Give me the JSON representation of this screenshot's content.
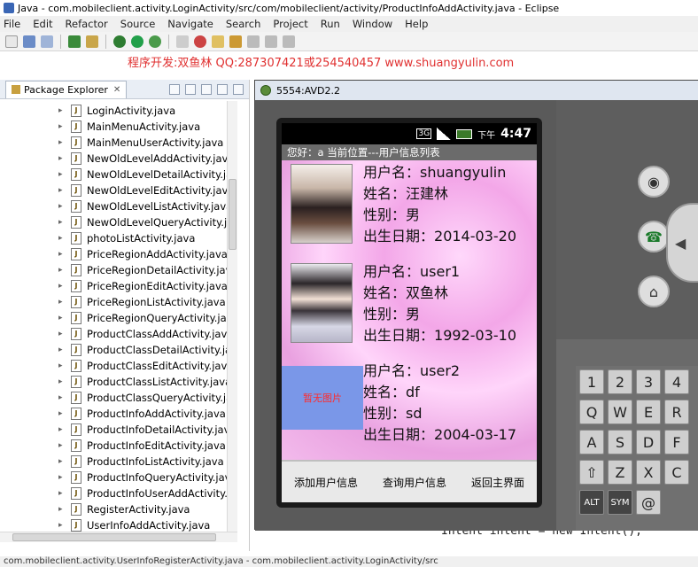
{
  "window": {
    "title": "Java - com.mobileclient.activity.LoginActivity/src/com/mobileclient/activity/ProductInfoAddActivity.java - Eclipse"
  },
  "menu": [
    "File",
    "Edit",
    "Refactor",
    "Source",
    "Navigate",
    "Search",
    "Project",
    "Run",
    "Window",
    "Help"
  ],
  "promo_text": "程序开发:双鱼林 QQ:287307421或254540457 www.shuangyulin.com",
  "package_explorer": {
    "tab_label": "Package Explorer",
    "files": [
      "LoginActivity.java",
      "MainMenuActivity.java",
      "MainMenuUserActivity.java",
      "NewOldLevelAddActivity.java",
      "NewOldLevelDetailActivity.java",
      "NewOldLevelEditActivity.java",
      "NewOldLevelListActivity.java",
      "NewOldLevelQueryActivity.java",
      "photoListActivity.java",
      "PriceRegionAddActivity.java",
      "PriceRegionDetailActivity.java",
      "PriceRegionEditActivity.java",
      "PriceRegionListActivity.java",
      "PriceRegionQueryActivity.java",
      "ProductClassAddActivity.java",
      "ProductClassDetailActivity.java",
      "ProductClassEditActivity.java",
      "ProductClassListActivity.java",
      "ProductClassQueryActivity.java",
      "ProductInfoAddActivity.java",
      "ProductInfoDetailActivity.java",
      "ProductInfoEditActivity.java",
      "ProductInfoListActivity.java",
      "ProductInfoQueryActivity.java",
      "ProductInfoUserAddActivity.java",
      "RegisterActivity.java",
      "UserInfoAddActivity.java"
    ]
  },
  "editor": {
    "code_line_keyword": "Intent intent = new Intent();"
  },
  "emulator": {
    "title": "5554:AVD2.2",
    "status_bar": {
      "ampm": "下午",
      "time": "4:47"
    },
    "appbar_text": "您好：a   当前位置---用户信息列表",
    "users": [
      {
        "username_label": "用户名：",
        "username": "shuangyulin",
        "name_label": "姓名：",
        "name": "汪建林",
        "gender_label": "性别：",
        "gender": "男",
        "birth_label": "出生日期：",
        "birth": "2014-03-20",
        "photo_placeholder": ""
      },
      {
        "username_label": "用户名：",
        "username": "user1",
        "name_label": "姓名：",
        "name": "双鱼林",
        "gender_label": "性别：",
        "gender": "男",
        "birth_label": "出生日期：",
        "birth": "1992-03-10",
        "photo_placeholder": ""
      },
      {
        "username_label": "用户名：",
        "username": "user2",
        "name_label": "姓名：",
        "name": "df",
        "gender_label": "性别：",
        "gender": "sd",
        "birth_label": "出生日期：",
        "birth": "2004-03-17",
        "photo_placeholder": "暂无图片"
      }
    ],
    "bottom_buttons": {
      "add": "添加用户信息",
      "query": "查询用户信息",
      "back": "返回主界面"
    },
    "keyboard": {
      "row1": [
        "1",
        "2",
        "3",
        "4"
      ],
      "row2": [
        "Q",
        "W",
        "E",
        "R"
      ],
      "row3": [
        "A",
        "S",
        "D",
        "F"
      ],
      "row4": [
        "⇧",
        "Z",
        "X",
        "C"
      ],
      "row5": [
        "ALT",
        "SYM",
        "@",
        ""
      ]
    }
  },
  "status_bar_text": "com.mobileclient.activity.UserInfoRegisterActivity.java - com.mobileclient.activity.LoginActivity/src"
}
